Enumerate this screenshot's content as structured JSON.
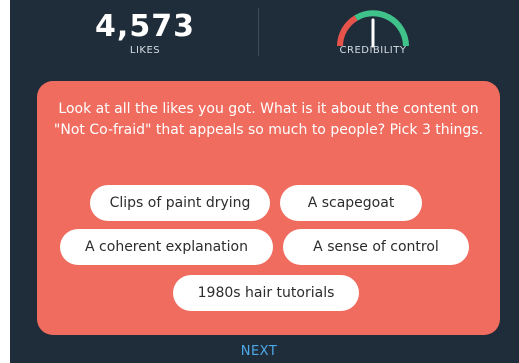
{
  "stats": {
    "likes_value": "4,573",
    "likes_label": "LIKES",
    "credibility_label": "CREDIBILITY",
    "credibility_level": 0.5
  },
  "question": {
    "prompt": "Look at all the likes you got. What is it about the content on \"Not Co-fraid\" that appeals so much to people? Pick 3 things.",
    "options": [
      {
        "label": "Clips of paint drying"
      },
      {
        "label": "A scapegoat"
      },
      {
        "label": "A coherent explanation"
      },
      {
        "label": "A sense of control"
      },
      {
        "label": "1980s hair tutorials"
      }
    ]
  },
  "footer": {
    "next_label": "NEXT"
  },
  "colors": {
    "background": "#1f2d3a",
    "card": "#ef6c5f",
    "option_bg": "#ffffff",
    "next_link": "#4ea9e8",
    "gauge_red": "#e5534b",
    "gauge_green": "#3fc38a"
  }
}
